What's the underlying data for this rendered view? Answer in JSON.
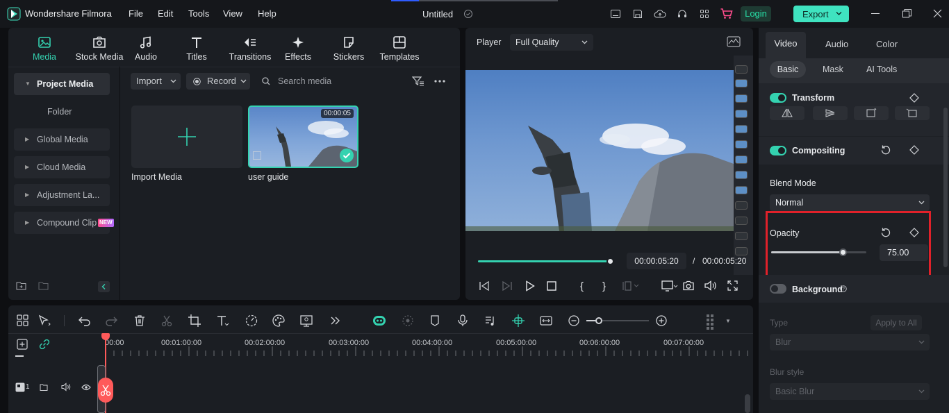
{
  "app": {
    "title": "Wondershare Filmora",
    "project_title": "Untitled"
  },
  "menu": [
    "File",
    "Edit",
    "Tools",
    "View",
    "Help"
  ],
  "header": {
    "login_label": "Login",
    "export_label": "Export"
  },
  "colors": {
    "accent": "#34d2b0",
    "export_bg": "#3fe3c0",
    "highlight_box": "#e0212a",
    "login_text": "#28e0a8"
  },
  "top_tabs": [
    {
      "label": "Media",
      "icon": "media-icon"
    },
    {
      "label": "Stock Media",
      "icon": "stock-media-icon"
    },
    {
      "label": "Audio",
      "icon": "music-note-icon"
    },
    {
      "label": "Titles",
      "icon": "titles-icon"
    },
    {
      "label": "Transitions",
      "icon": "transitions-icon"
    },
    {
      "label": "Effects",
      "icon": "effects-icon"
    },
    {
      "label": "Stickers",
      "icon": "stickers-icon"
    },
    {
      "label": "Templates",
      "icon": "templates-icon"
    }
  ],
  "sidebar": {
    "project_media": "Project Media",
    "folder": "Folder",
    "items": [
      "Global Media",
      "Cloud Media",
      "Adjustment La...",
      "Compound Clip"
    ],
    "new_badge": "NEW"
  },
  "media": {
    "import_label": "Import",
    "record_label": "Record",
    "search_placeholder": "Search media",
    "import_tile_label": "Import Media",
    "clip_name": "user guide",
    "clip_duration": "00:00:05"
  },
  "player": {
    "label": "Player",
    "quality": "Full Quality",
    "current_time": "00:00:05:20",
    "separator": "/",
    "total_time": "00:00:05:20",
    "progress": 1.0
  },
  "timeline": {
    "ruler": [
      "00:00",
      "00:01:00:00",
      "00:02:00:00",
      "00:03:00:00",
      "00:04:00:00",
      "00:05:00:00",
      "00:06:00:00",
      "00:07:00:00"
    ],
    "track_number": "1"
  },
  "right_panel": {
    "tabs": [
      "Video",
      "Audio",
      "Color"
    ],
    "subtabs": [
      "Basic",
      "Mask",
      "AI Tools"
    ],
    "transform": "Transform",
    "compositing": "Compositing",
    "blend_mode_label": "Blend Mode",
    "blend_mode_value": "Normal",
    "opacity_label": "Opacity",
    "opacity_value": "75.00",
    "opacity_fraction": 0.75,
    "background": "Background",
    "type_label": "Type",
    "apply_all": "Apply to All",
    "type_value": "Blur",
    "blur_style_label": "Blur style",
    "blur_style_value": "Basic Blur"
  }
}
